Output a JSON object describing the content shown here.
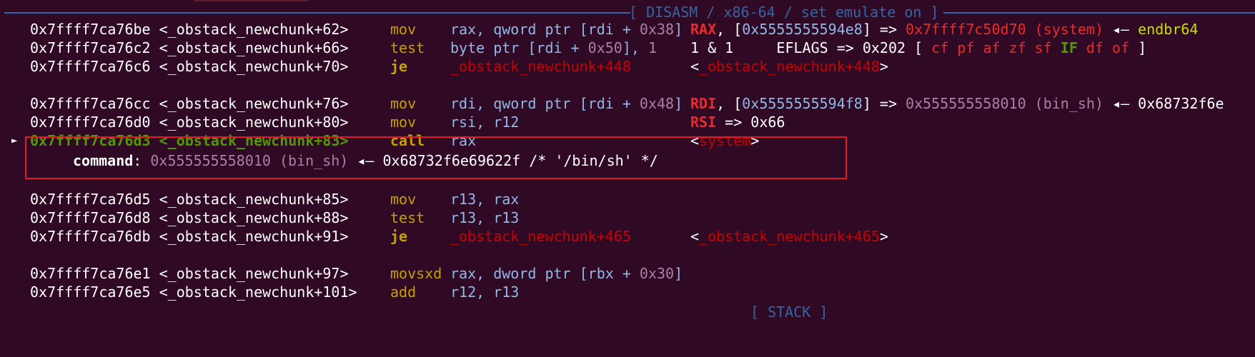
{
  "header": {
    "title": "[ DISASM / x86-64 / set emulate on ]"
  },
  "current_marker": "►",
  "rows": [
    {
      "addr": "0x7ffff7ca76be <_obstack_newchunk+62>",
      "mnem": "mov",
      "op_a": "rax, qword ptr [rdi + ",
      "op_b": "0x38",
      "op_c": "]",
      "reg": "RAX",
      "ann_a": ", [",
      "ann_addr": "0x5555555594e8",
      "ann_b": "] => ",
      "ann_val": "0x7ffff7c50d70 (system)",
      "ann_arrow": " ◂— ",
      "ann_end": "endbr64"
    },
    {
      "addr": "0x7ffff7ca76c2 <_obstack_newchunk+66>",
      "mnem": "test",
      "op_a": "byte ptr [rdi + ",
      "op_b": "0x50",
      "op_c": "], ",
      "op_d": "1",
      "eval": "1 & 1     EFLAGS => 0x202 [ ",
      "flags_a": "cf pf af zf sf",
      "flag_if": "IF",
      "flags_b": "df of",
      "flags_end": " ]"
    },
    {
      "addr": "0x7ffff7ca76c6 <_obstack_newchunk+70>",
      "mnem": "je",
      "target": "_obstack_newchunk+448",
      "sym_l": "<",
      "sym": "_obstack_newchunk+448",
      "sym_r": ">"
    },
    {
      "addr": "0x7ffff7ca76cc <_obstack_newchunk+76>",
      "mnem": "mov",
      "op_a": "rdi, qword ptr [rdi + ",
      "op_b": "0x48",
      "op_c": "]",
      "reg": "RDI",
      "ann_a": ", [",
      "ann_addr": "0x5555555594f8",
      "ann_b": "] => ",
      "ann_val": "0x555555558010 (bin_sh)",
      "ann_arrow": " ◂— ",
      "ann_end": "0x68732f6e"
    },
    {
      "addr": "0x7ffff7ca76d0 <_obstack_newchunk+80>",
      "mnem": "mov",
      "op_a": "rsi, r12",
      "reg": "RSI",
      "ann_b": " => 0x66"
    },
    {
      "addr": "0x7ffff7ca76d3 <_obstack_newchunk+83>",
      "mnem": "call",
      "op_a": "rax",
      "sym_l": "<",
      "sym": "system",
      "sym_r": ">"
    },
    {
      "label": "command",
      "colon": ": ",
      "val": "0x555555558010 (bin_sh)",
      "arrow": " ◂— ",
      "rest": "0x68732f6e69622f /* '/bin/sh' */"
    },
    {
      "addr": "0x7ffff7ca76d5 <_obstack_newchunk+85>",
      "mnem": "mov",
      "op_a": "r13, rax"
    },
    {
      "addr": "0x7ffff7ca76d8 <_obstack_newchunk+88>",
      "mnem": "test",
      "op_a": "r13, r13"
    },
    {
      "addr": "0x7ffff7ca76db <_obstack_newchunk+91>",
      "mnem": "je",
      "target": "_obstack_newchunk+465",
      "sym_l": "<",
      "sym": "_obstack_newchunk+465",
      "sym_r": ">"
    },
    {
      "addr": "0x7ffff7ca76e1 <_obstack_newchunk+97>",
      "mnem": "movsxd",
      "op_a": "rax, dword ptr [rbx + ",
      "op_b": "0x30",
      "op_c": "]"
    },
    {
      "addr": "0x7ffff7ca76e5 <_obstack_newchunk+101>",
      "mnem": "add",
      "op_a": "r12, r13"
    }
  ],
  "footer_hint": "[ STACK ]",
  "colors": {
    "background": "#300a24",
    "header": "#3465a4",
    "highlight_box": "#e01b24"
  }
}
